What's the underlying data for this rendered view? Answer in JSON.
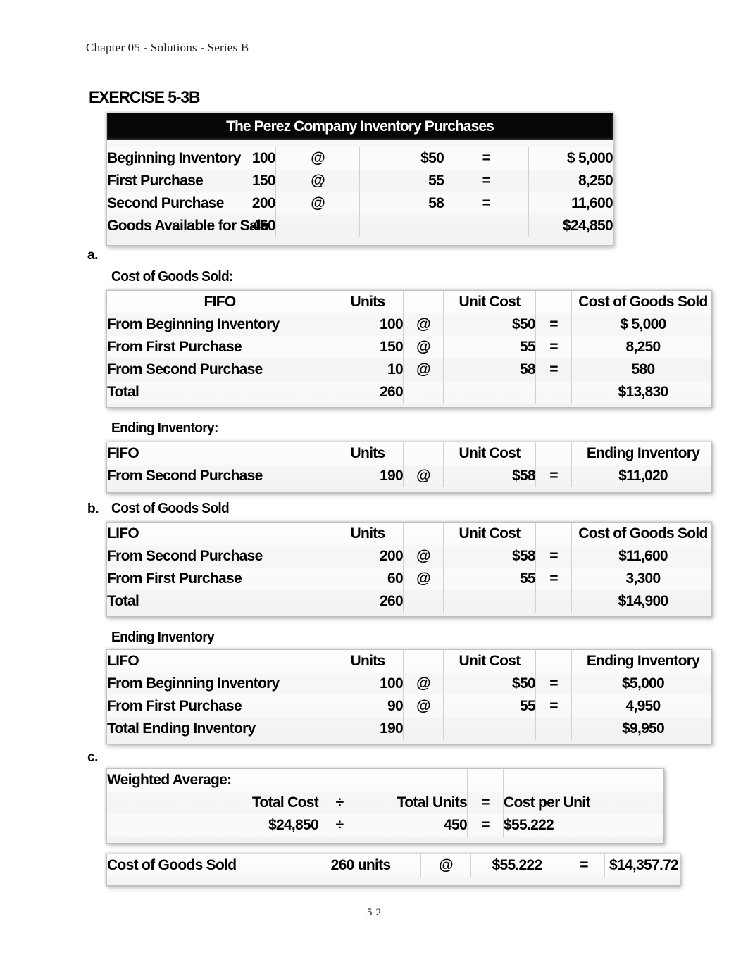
{
  "page": {
    "running_head": "Chapter 05 - Solutions - Series B",
    "footer": "5-2",
    "exercise_title": "EXERCISE 5-3B"
  },
  "purchases_sheet": {
    "title": "The Perez Company Inventory Purchases",
    "rows": [
      {
        "label": "Beginning Inventory",
        "units": "100",
        "op": "@",
        "unit_cost": "$50",
        "eq": "=",
        "amount": "$  5,000"
      },
      {
        "label": "First Purchase",
        "units": "150",
        "op": "@",
        "unit_cost": "55",
        "eq": "=",
        "amount": "8,250"
      },
      {
        "label": "Second Purchase",
        "units": "200",
        "op": "@",
        "unit_cost": "58",
        "eq": "=",
        "amount": "11,600"
      },
      {
        "label": "Goods Available for Sale",
        "units": "450",
        "op": "",
        "unit_cost": "",
        "eq": "",
        "amount": "$24,850"
      }
    ]
  },
  "part_a": {
    "letter": "a.",
    "cogs_caption": "Cost of Goods Sold:",
    "cogs_sheet": {
      "header": {
        "method": "FIFO",
        "units": "Units",
        "unit_cost": "Unit Cost",
        "amount": "Cost of Goods Sold"
      },
      "rows": [
        {
          "label": "From Beginning Inventory",
          "units": "100",
          "op": "@",
          "unit_cost": "$50",
          "eq": "=",
          "amount": "$ 5,000"
        },
        {
          "label": "From First Purchase",
          "units": "150",
          "op": "@",
          "unit_cost": "55",
          "eq": "=",
          "amount": "8,250"
        },
        {
          "label": "From Second Purchase",
          "units": "10",
          "op": "@",
          "unit_cost": "58",
          "eq": "=",
          "amount": "580"
        },
        {
          "label": "Total",
          "units": "260",
          "op": "",
          "unit_cost": "",
          "eq": "",
          "amount": "$13,830"
        }
      ]
    },
    "ending_caption": "Ending Inventory:",
    "ending_sheet": {
      "header": {
        "method": "FIFO",
        "units": "Units",
        "unit_cost": "Unit Cost",
        "amount": "Ending Inventory"
      },
      "rows": [
        {
          "label": "From Second Purchase",
          "units": "190",
          "op": "@",
          "unit_cost": "$58",
          "eq": "=",
          "amount": "$11,020"
        }
      ]
    }
  },
  "part_b": {
    "letter": "b.",
    "cogs_caption": "Cost of Goods Sold",
    "cogs_sheet": {
      "header": {
        "method": "LIFO",
        "units": "Units",
        "unit_cost": "Unit Cost",
        "amount": "Cost of Goods Sold"
      },
      "rows": [
        {
          "label": "From Second Purchase",
          "units": "200",
          "op": "@",
          "unit_cost": "$58",
          "eq": "=",
          "amount": "$11,600"
        },
        {
          "label": "From First Purchase",
          "units": "60",
          "op": "@",
          "unit_cost": "55",
          "eq": "=",
          "amount": "3,300"
        },
        {
          "label": "Total",
          "units": "260",
          "op": "",
          "unit_cost": "",
          "eq": "",
          "amount": "$14,900"
        }
      ]
    },
    "ending_caption": "Ending Inventory",
    "ending_sheet": {
      "header": {
        "method": "LIFO",
        "units": "Units",
        "unit_cost": "Unit Cost",
        "amount": "Ending Inventory"
      },
      "rows": [
        {
          "label": "From Beginning Inventory",
          "units": "100",
          "op": "@",
          "unit_cost": "$50",
          "eq": "=",
          "amount": "$5,000"
        },
        {
          "label": "From First Purchase",
          "units": "90",
          "op": "@",
          "unit_cost": "55",
          "eq": "=",
          "amount": "4,950"
        },
        {
          "label": "Total Ending Inventory",
          "units": "190",
          "op": "",
          "unit_cost": "",
          "eq": "",
          "amount": "$9,950"
        }
      ]
    }
  },
  "part_c": {
    "letter": "c.",
    "weighted_sheet": {
      "caption": "Weighted Average:",
      "header": {
        "total_cost": "Total Cost",
        "div": "÷",
        "total_units": "Total Units",
        "eq": "=",
        "cost_per_unit": "Cost per Unit"
      },
      "values": {
        "total_cost": "$24,850",
        "div": "÷",
        "total_units": "450",
        "eq": "=",
        "cost_per_unit": "$55.222"
      }
    },
    "cogs_sheet": {
      "row": {
        "label": "Cost of Goods Sold",
        "units": "260 units",
        "op": "@",
        "unit_cost": "$55.222",
        "eq": "=",
        "amount": "$14,357.72"
      }
    }
  }
}
